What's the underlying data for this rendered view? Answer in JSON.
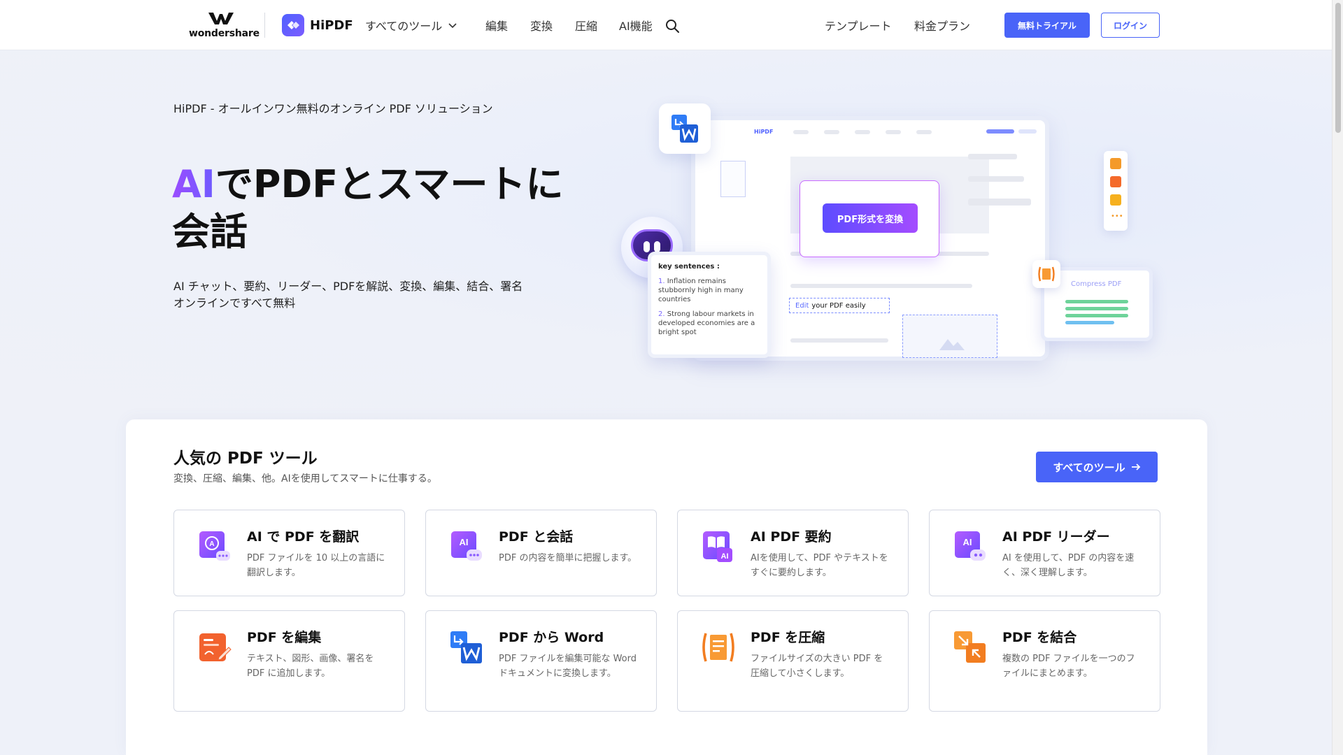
{
  "nav": {
    "brand": "wondershare",
    "product": "HiPDF",
    "all_tools": "すべてのツール",
    "links": [
      "編集",
      "変換",
      "圧縮",
      "AI機能"
    ],
    "right_links": [
      "テンプレート",
      "料金プラン"
    ],
    "trial_button": "無料トライアル",
    "login_button": "ログイン"
  },
  "hero": {
    "subtitle": "HiPDF - オールインワン無料のオンライン PDF ソリューション",
    "title_ai": "AI",
    "title_rest": "でPDFとスマートに会話",
    "description_line1": "AI チャット、要約、リーダー、PDFを解説、変換、編集、結合、署名",
    "description_line2": "オンラインですべて無料",
    "illustration": {
      "mini_brand": "HiPDF",
      "convert_button": "PDF形式を変換",
      "chat_heading": "key sentences :",
      "chat_item1_num": "1.",
      "chat_item1": "Inflation remains stubbornly high in many countries",
      "chat_item2_num": "2.",
      "chat_item2": "Strong labour markets in developed economies are a bright spot",
      "edit_word": "Edit",
      "edit_rest": "your PDF easily",
      "compress_label": "Compress PDF"
    }
  },
  "tools": {
    "title": "人気の PDF ツール",
    "subtitle": "変換、圧縮、編集、他。AIを使用してスマートに仕事する。",
    "all_button": "すべてのツール",
    "cards": [
      {
        "title": "AI で PDF を翻訳",
        "desc": "PDF ファイルを 10 以上の言語に翻訳します。",
        "icon": "translate-icon"
      },
      {
        "title": "PDF と会話",
        "desc": "PDF の内容を簡単に把握します。",
        "icon": "chat-icon"
      },
      {
        "title": "AI PDF 要約",
        "desc": "AIを使用して、PDF やテキストをすぐに要約します。",
        "icon": "summary-icon"
      },
      {
        "title": "AI PDF リーダー",
        "desc": "AI を使用して、PDF の内容を速く、深く理解します。",
        "icon": "reader-icon"
      },
      {
        "title": "PDF を編集",
        "desc": "テキスト、図形、画像、署名を PDF に追加します。",
        "icon": "edit-icon"
      },
      {
        "title": "PDF から Word",
        "desc": "PDF ファイルを編集可能な Word ドキュメントに変換します。",
        "icon": "word-icon"
      },
      {
        "title": "PDF を圧縮",
        "desc": "ファイルサイズの大きい PDF を圧縮して小さくします。",
        "icon": "compress-icon"
      },
      {
        "title": "PDF を結合",
        "desc": "複数の PDF ファイルを一つのファイルにまとめます。",
        "icon": "merge-icon"
      }
    ]
  },
  "colors": {
    "accent": "#4964f8",
    "ai_gradient_start": "#9a4dff",
    "ai_gradient_end": "#6e5bff"
  }
}
